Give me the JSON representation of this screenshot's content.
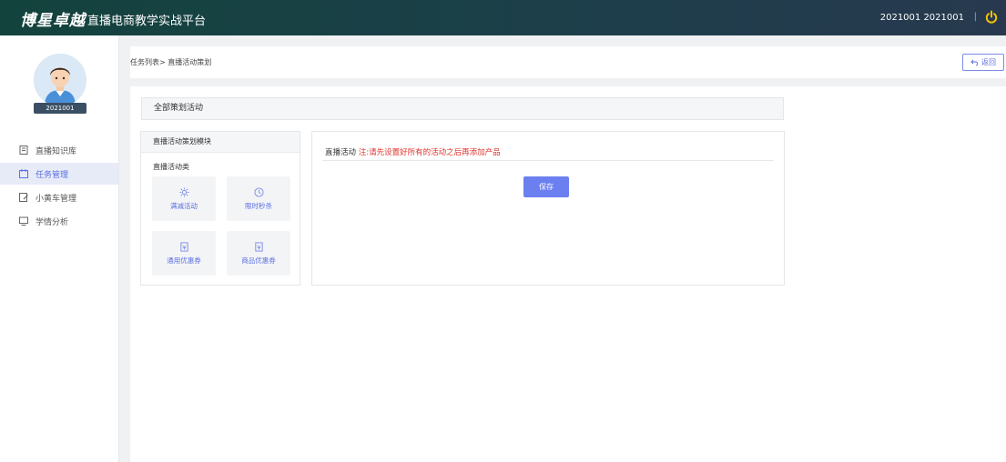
{
  "header": {
    "brand": "博星卓越",
    "title": "直播电商教学实战平台",
    "user": "2021001 2021001",
    "separator": "|"
  },
  "sidebar": {
    "avatar_label": "2021001",
    "items": [
      {
        "label": "直播知识库",
        "icon": "building-icon",
        "active": false
      },
      {
        "label": "任务管理",
        "icon": "calendar-icon",
        "active": true
      },
      {
        "label": "小黄车管理",
        "icon": "edit-icon",
        "active": false
      },
      {
        "label": "学情分析",
        "icon": "monitor-icon",
        "active": false
      }
    ]
  },
  "breadcrumb": {
    "text": "任务列表> 直播活动策划",
    "back_label": "返回"
  },
  "main": {
    "section_title": "全部策划活动",
    "module": {
      "title": "直播活动策划模块",
      "subtitle": "直播活动类",
      "tiles": [
        {
          "label": "满减活动",
          "icon": "gear-icon"
        },
        {
          "label": "限时秒杀",
          "icon": "clock-icon"
        },
        {
          "label": "通用优惠券",
          "icon": "coupon-icon"
        },
        {
          "label": "商品优惠券",
          "icon": "coupon-icon"
        }
      ]
    },
    "detail": {
      "title": "直播活动",
      "note": "注:请先设置好所有的活动之后再添加产品",
      "save_label": "保存"
    }
  },
  "colors": {
    "accent": "#5b6ee1",
    "button": "#6c7ff0",
    "warning": "#e0322c",
    "header_start": "#13433d",
    "header_end": "#28394f"
  }
}
